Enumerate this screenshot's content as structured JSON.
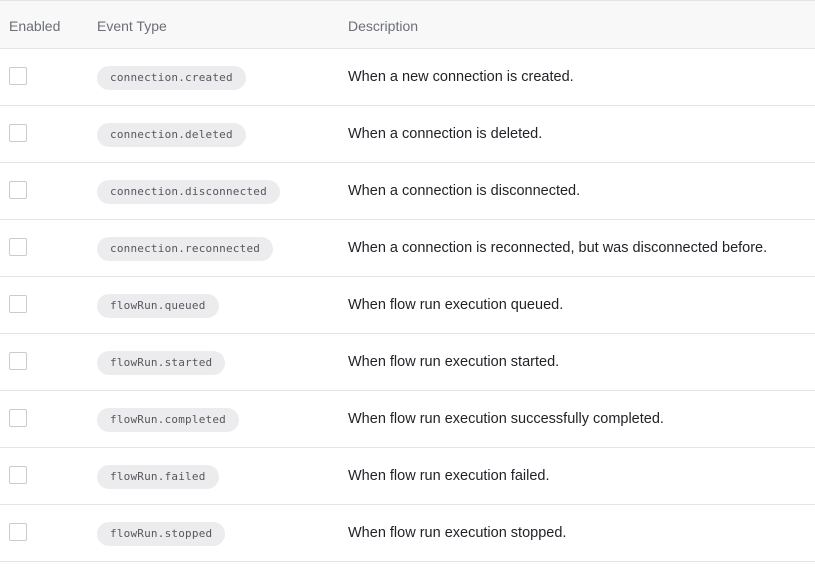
{
  "table": {
    "headers": {
      "enabled": "Enabled",
      "event_type": "Event Type",
      "description": "Description"
    },
    "rows": [
      {
        "enabled": false,
        "event_type": "connection.created",
        "description": "When a new connection is created."
      },
      {
        "enabled": false,
        "event_type": "connection.deleted",
        "description": "When a connection is deleted."
      },
      {
        "enabled": false,
        "event_type": "connection.disconnected",
        "description": "When a connection is disconnected."
      },
      {
        "enabled": false,
        "event_type": "connection.reconnected",
        "description": "When a connection is reconnected, but was disconnected before."
      },
      {
        "enabled": false,
        "event_type": "flowRun.queued",
        "description": "When flow run execution queued."
      },
      {
        "enabled": false,
        "event_type": "flowRun.started",
        "description": "When flow run execution started."
      },
      {
        "enabled": false,
        "event_type": "flowRun.completed",
        "description": "When flow run execution successfully completed."
      },
      {
        "enabled": false,
        "event_type": "flowRun.failed",
        "description": "When flow run execution failed."
      },
      {
        "enabled": false,
        "event_type": "flowRun.stopped",
        "description": "When flow run execution stopped."
      }
    ]
  },
  "colors": {
    "header_bg": "#f8f8f9",
    "border": "#e4e4e7",
    "pill_bg": "#ececee",
    "text": "#1f2126",
    "muted_text": "#6b6f76"
  }
}
